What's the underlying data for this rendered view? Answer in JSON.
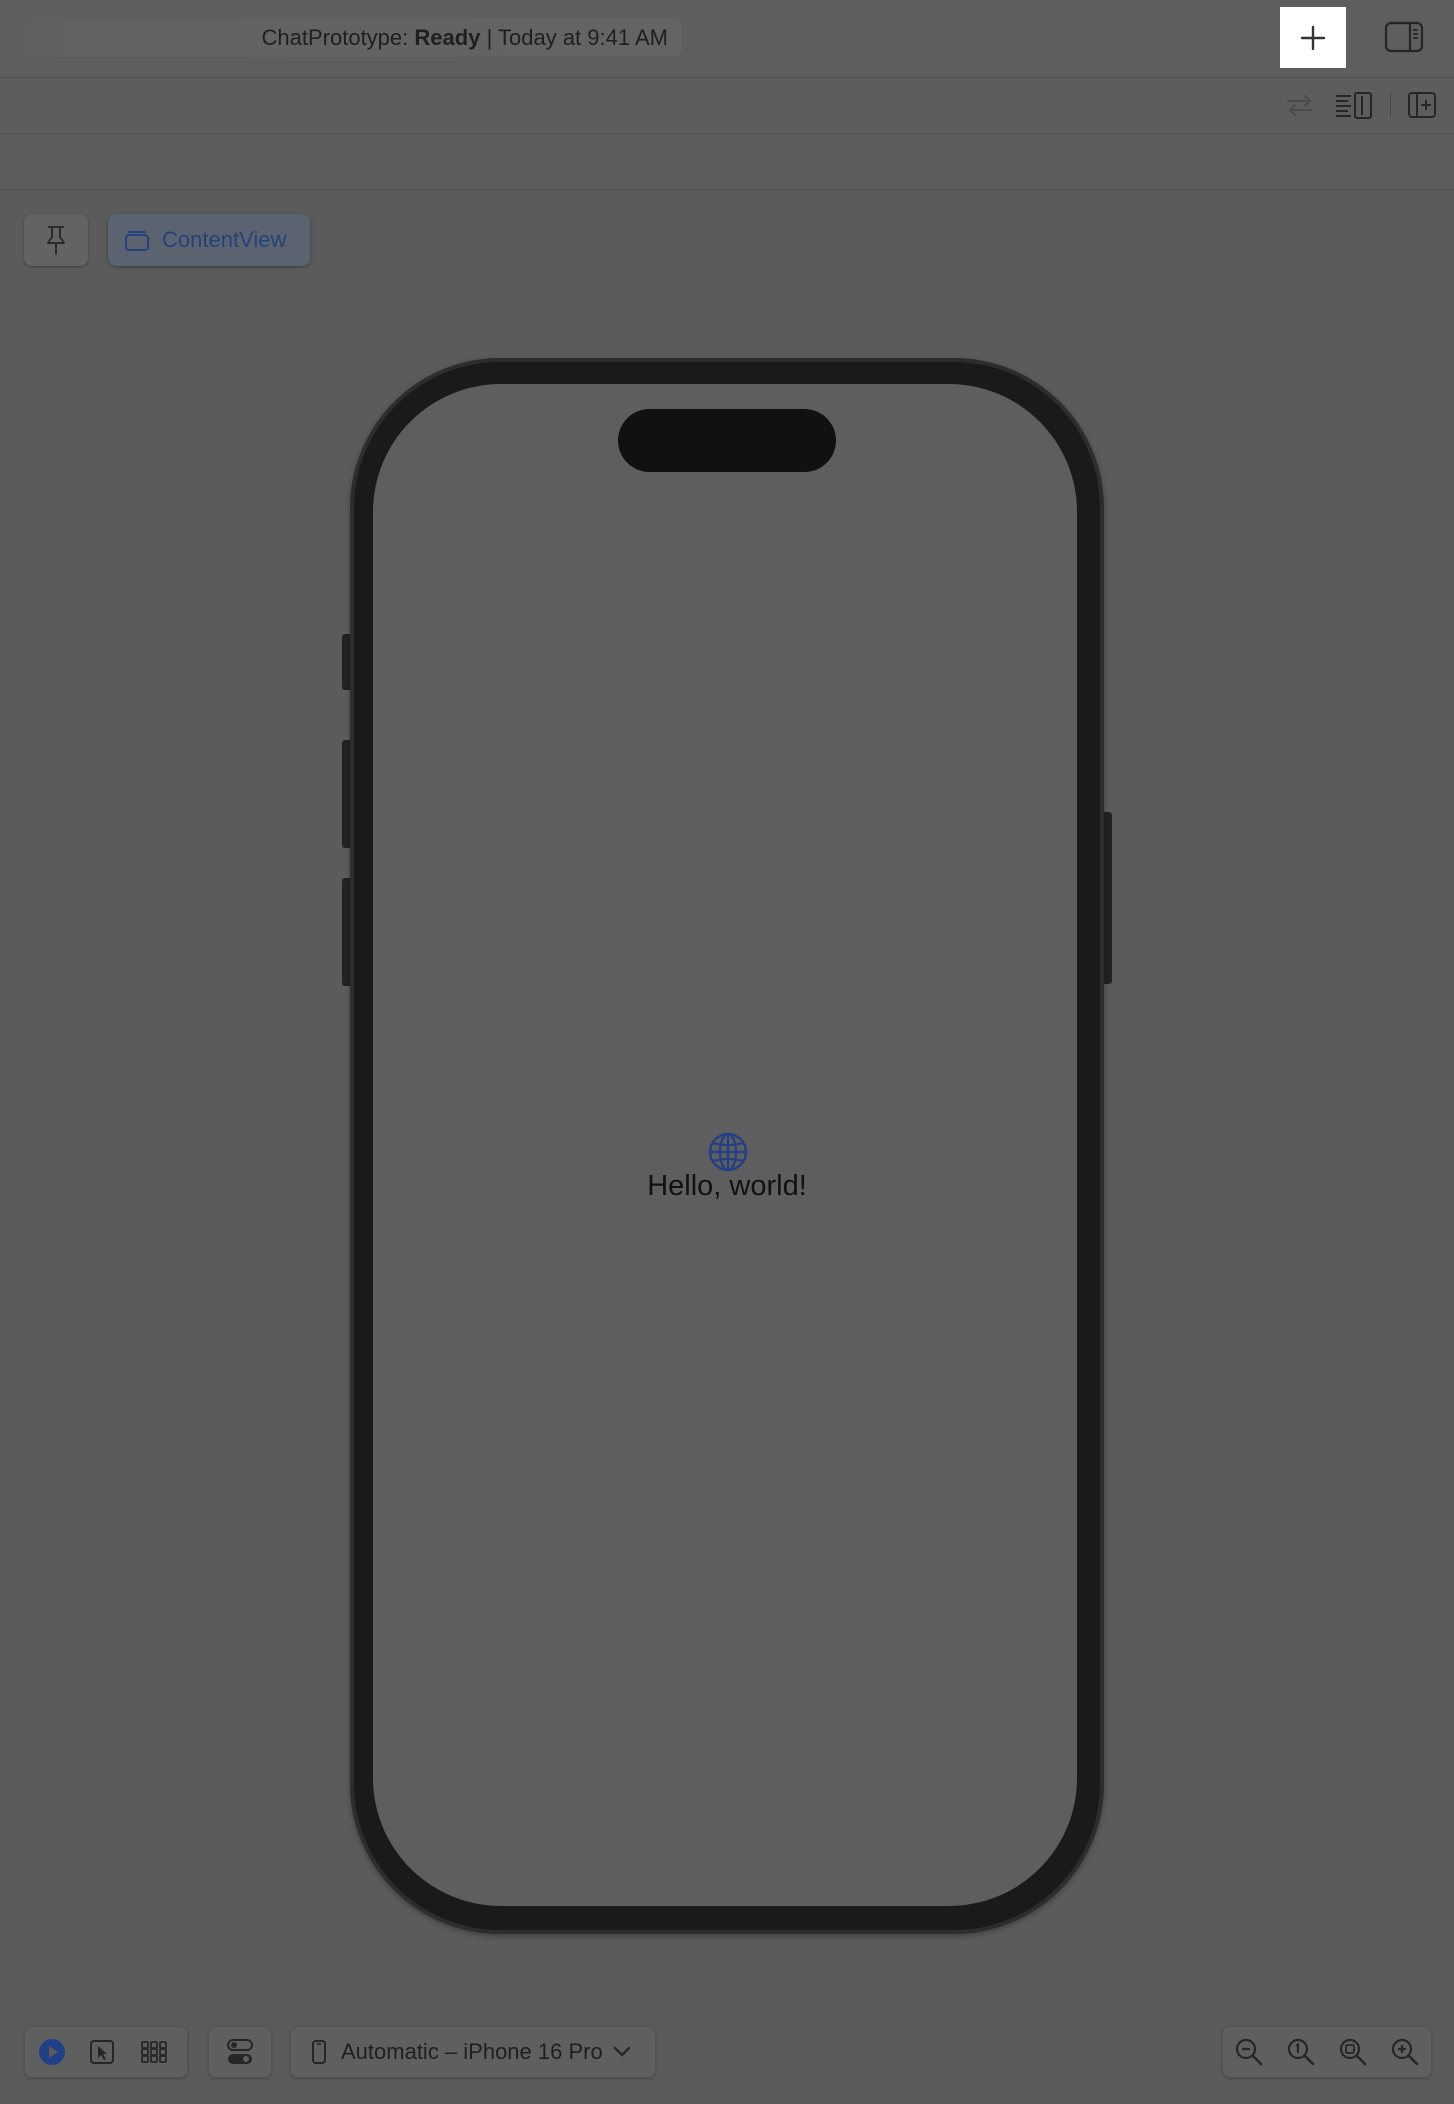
{
  "titlebar": {
    "project": "ChatPrototype:",
    "status": "Ready",
    "separator": "|",
    "timestamp": "Today at 9:41 AM",
    "add_icon": "plus-icon",
    "inspector_icon": "sidebar-right-icon"
  },
  "jumpbar": {
    "icons": [
      "swap-arrows-icon",
      "adjust-editor-icon",
      "add-editor-icon"
    ]
  },
  "canvas": {
    "pin_icon": "pin-icon",
    "preview_chip": {
      "label": "ContentView",
      "icon": "stack-icon"
    }
  },
  "preview": {
    "icon": "globe-icon",
    "text": "Hello, world!",
    "accent": "#1f3f86"
  },
  "bottom_toolbar": {
    "modes": [
      "play-icon",
      "selectable-icon",
      "variants-icon"
    ],
    "settings_icon": "device-settings-icon",
    "device": {
      "label": "Automatic – iPhone 16 Pro",
      "icon": "iphone-icon",
      "chevron": "chevron-down-icon"
    },
    "zoom": [
      "zoom-out-icon",
      "zoom-100-icon",
      "zoom-fit-icon",
      "zoom-in-icon"
    ]
  }
}
